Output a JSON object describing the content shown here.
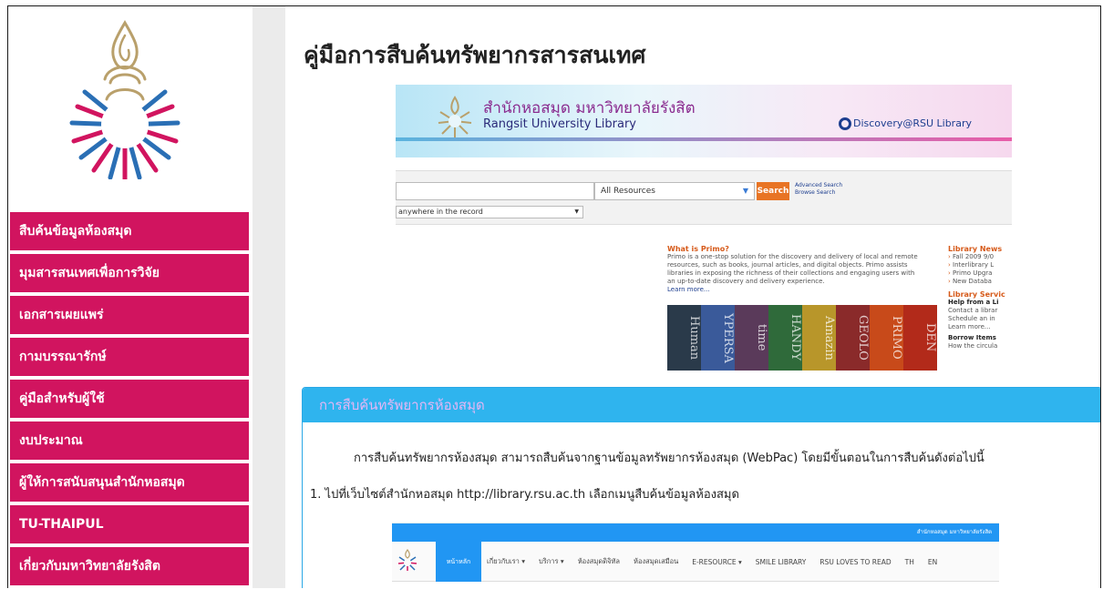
{
  "sidebar": {
    "menu": [
      {
        "label": "สืบค้นข้อมูลห้องสมุด"
      },
      {
        "label": "มุมสารสนเทศเพื่อการวิจัย"
      },
      {
        "label": "เอกสารเผยแพร่"
      },
      {
        "label": "กามบรรณารักษ์"
      },
      {
        "label": "คู่มือสำหรับผู้ใช้"
      },
      {
        "label": "งบประมาณ"
      },
      {
        "label": "ผู้ให้การสนับสนุนสำนักหอสมุด"
      },
      {
        "label": "TU-THAIPUL"
      },
      {
        "label": "เกี่ยวกับมหาวิทยาลัยรังสิต"
      }
    ]
  },
  "main": {
    "title": "คู่มือการสืบค้นทรัพยากรสารสนเทศ",
    "screenshot1": {
      "banner_th": "สำนักหอสมุด มหาวิทยาลัยรังสิต",
      "banner_en": "Rangsit University Library",
      "discovery": "Discovery@RSU Library",
      "search_scope": "All Resources",
      "search_button": "Search",
      "advanced_search": "Advanced Search",
      "browse_search": "Browse Search",
      "field_select": "anywhere in the record",
      "what_primo_heading": "What is Primo?",
      "what_primo_text": "Primo is a one-stop solution for the discovery and delivery of local and remote resources, such as books, journal articles, and digital objects. Primo assists libraries in exposing the richness of their collections and engaging users with an up-to-date discovery and delivery experience.",
      "learn_more": "Learn more...",
      "books": [
        "Human",
        "YPERSA",
        "time",
        "HANDY",
        "Amazin",
        "GEOLO",
        "PRIMO",
        "DEN"
      ],
      "news_heading": "Library News",
      "news_items": [
        "Fall 2009 9/0",
        "Interlibrary L",
        "Primo Upgra",
        "New Databa"
      ],
      "services_heading": "Library Servic",
      "help_title": "Help from a Li",
      "help_lines": [
        "Contact a librar",
        "Schedule an in",
        "Learn more..."
      ],
      "borrow_title": "Borrow Items",
      "borrow_line": "How the circula"
    },
    "panel": {
      "heading": "การสืบค้นทรัพยากรห้องสมุด",
      "para1": "การสืบค้นทรัพยากรห้องสมุด สามารถสืบค้นจากฐานข้อมูลทรัพยากรห้องสมุด (WebPac) โดยมีขั้นตอนในการสืบค้นดังต่อไปนี้",
      "para2": "1. ไปที่เว็บไซต์สำนักหอสมุด http://library.rsu.ac.th เลือกเมนูสืบค้นข้อมูลห้องสมุด"
    },
    "screenshot2": {
      "topbar_text": "สำนักหอสมุด มหาวิทยาลัยรังสิต",
      "home": "หน้าหลัก",
      "nav": [
        "เกี่ยวกับเรา ▾",
        "บริการ ▾",
        "ห้องสมุดดิจิทัล",
        "ห้องสมุดเสมือน",
        "E-RESOURCE ▾",
        "SMILE LIBRARY",
        "RSU LOVES TO READ",
        "TH",
        "EN"
      ]
    }
  },
  "colors": {
    "menu_bg": "#d1145f",
    "panel_header": "#2fb4ee",
    "gutter": "#ebebeb"
  }
}
